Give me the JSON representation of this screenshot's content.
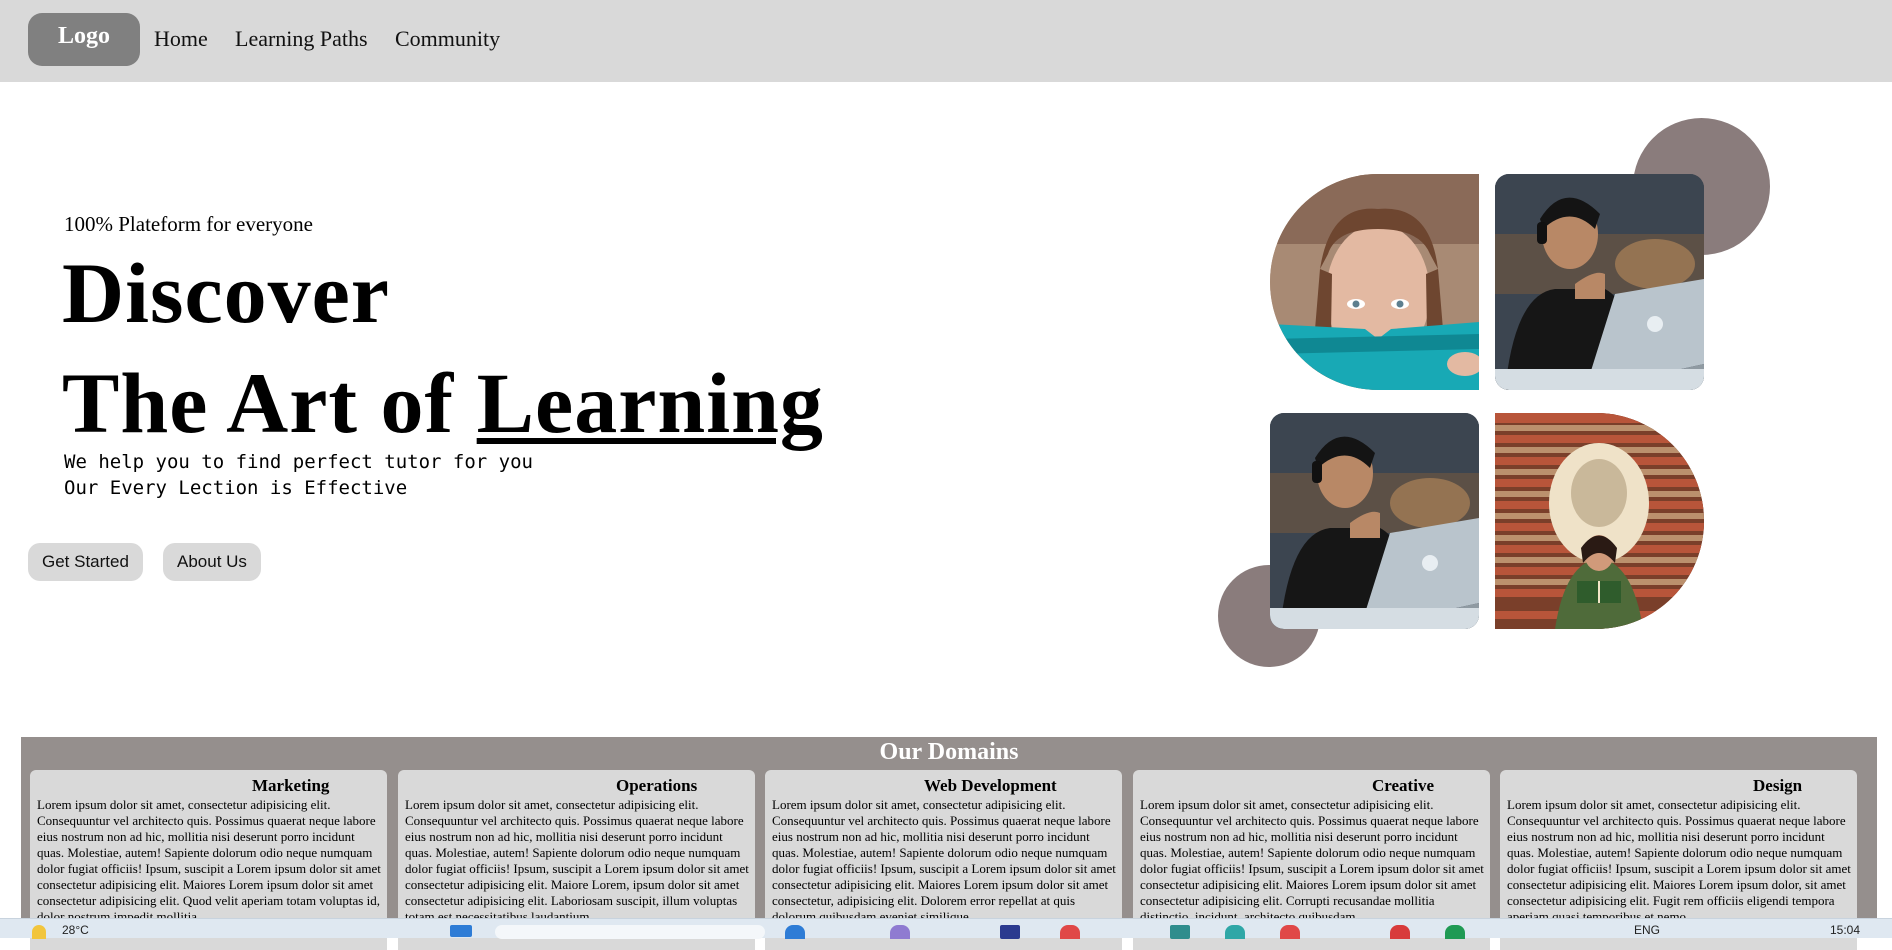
{
  "nav": {
    "logo": "Logo",
    "links": [
      "Home",
      "Learning Paths",
      "Community"
    ]
  },
  "hero": {
    "tagline": "100% Plateform for everyone",
    "line1": "Discover",
    "line2_prefix": "The Art of ",
    "line2_underlined": "Learning",
    "sub1": "We help you to find perfect tutor for you",
    "sub2": "Our Every Lection is Effective",
    "btn_primary": "Get Started",
    "btn_secondary": "About Us"
  },
  "collage": {
    "accent_color": "#8a7c7c",
    "images": [
      "woman-reading-book",
      "man-with-headphones-laptop",
      "man-with-headphones-laptop",
      "woman-reading-in-library"
    ]
  },
  "domains": {
    "title": "Our Domains",
    "cards": [
      {
        "title": "Marketing",
        "text": "Lorem ipsum dolor sit amet, consectetur adipisicing elit. Consequuntur vel architecto quis. Possimus quaerat neque labore eius nostrum non ad hic, mollitia nisi deserunt porro incidunt quas. Molestiae, autem! Sapiente dolorum odio neque numquam dolor fugiat officiis! Ipsum, suscipit a Lorem ipsum dolor sit amet consectetur adipisicing elit. Maiores Lorem ipsum dolor sit amet consectetur adipisicing elit. Quod velit aperiam totam voluptas id, dolor nostrum impedit mollitia"
      },
      {
        "title": "Operations",
        "text": "Lorem ipsum dolor sit amet, consectetur adipisicing elit. Consequuntur vel architecto quis. Possimus quaerat neque labore eius nostrum non ad hic, mollitia nisi deserunt porro incidunt quas. Molestiae, autem! Sapiente dolorum odio neque numquam dolor fugiat officiis! Ipsum, suscipit a Lorem ipsum dolor sit amet consectetur adipisicing elit. Maiore Lorem, ipsum dolor sit amet consectetur adipisicing elit. Laboriosam suscipit, illum voluptas totam est necessitatibus laudantium"
      },
      {
        "title": "Web Development",
        "text": "Lorem ipsum dolor sit amet, consectetur adipisicing elit. Consequuntur vel architecto quis. Possimus quaerat neque labore eius nostrum non ad hic, mollitia nisi deserunt porro incidunt quas. Molestiae, autem! Sapiente dolorum odio neque numquam dolor fugiat officiis! Ipsum, suscipit a Lorem ipsum dolor sit amet consectetur adipisicing elit. Maiores Lorem ipsum dolor sit amet consectetur, adipisicing elit. Dolorem error repellat at quis dolorum quibusdam eveniet similique"
      },
      {
        "title": "Creative",
        "text": "Lorem ipsum dolor sit amet, consectetur adipisicing elit. Consequuntur vel architecto quis. Possimus quaerat neque labore eius nostrum non ad hic, mollitia nisi deserunt porro incidunt quas. Molestiae, autem! Sapiente dolorum odio neque numquam dolor fugiat officiis! Ipsum, suscipit a Lorem ipsum dolor sit amet consectetur adipisicing elit. Maiores Lorem ipsum dolor sit amet consectetur adipisicing elit. Corrupti recusandae mollitia distinctio, incidunt, architecto quibusdam"
      },
      {
        "title": "Design",
        "text": "Lorem ipsum dolor sit amet, consectetur adipisicing elit. Consequuntur vel architecto quis. Possimus quaerat neque labore eius nostrum non ad hic, mollitia nisi deserunt porro incidunt quas. Molestiae, autem! Sapiente dolorum odio neque numquam dolor fugiat officiis! Ipsum, suscipit a Lorem ipsum dolor sit amet consectetur adipisicing elit. Maiores Lorem ipsum dolor, sit amet consectetur adipisicing elit. Fugit rem officiis eligendi tempora aperiam quasi temporibus et nemo"
      }
    ]
  },
  "taskbar": {
    "temperature": "28°C",
    "language": "ENG",
    "time": "15:04"
  }
}
